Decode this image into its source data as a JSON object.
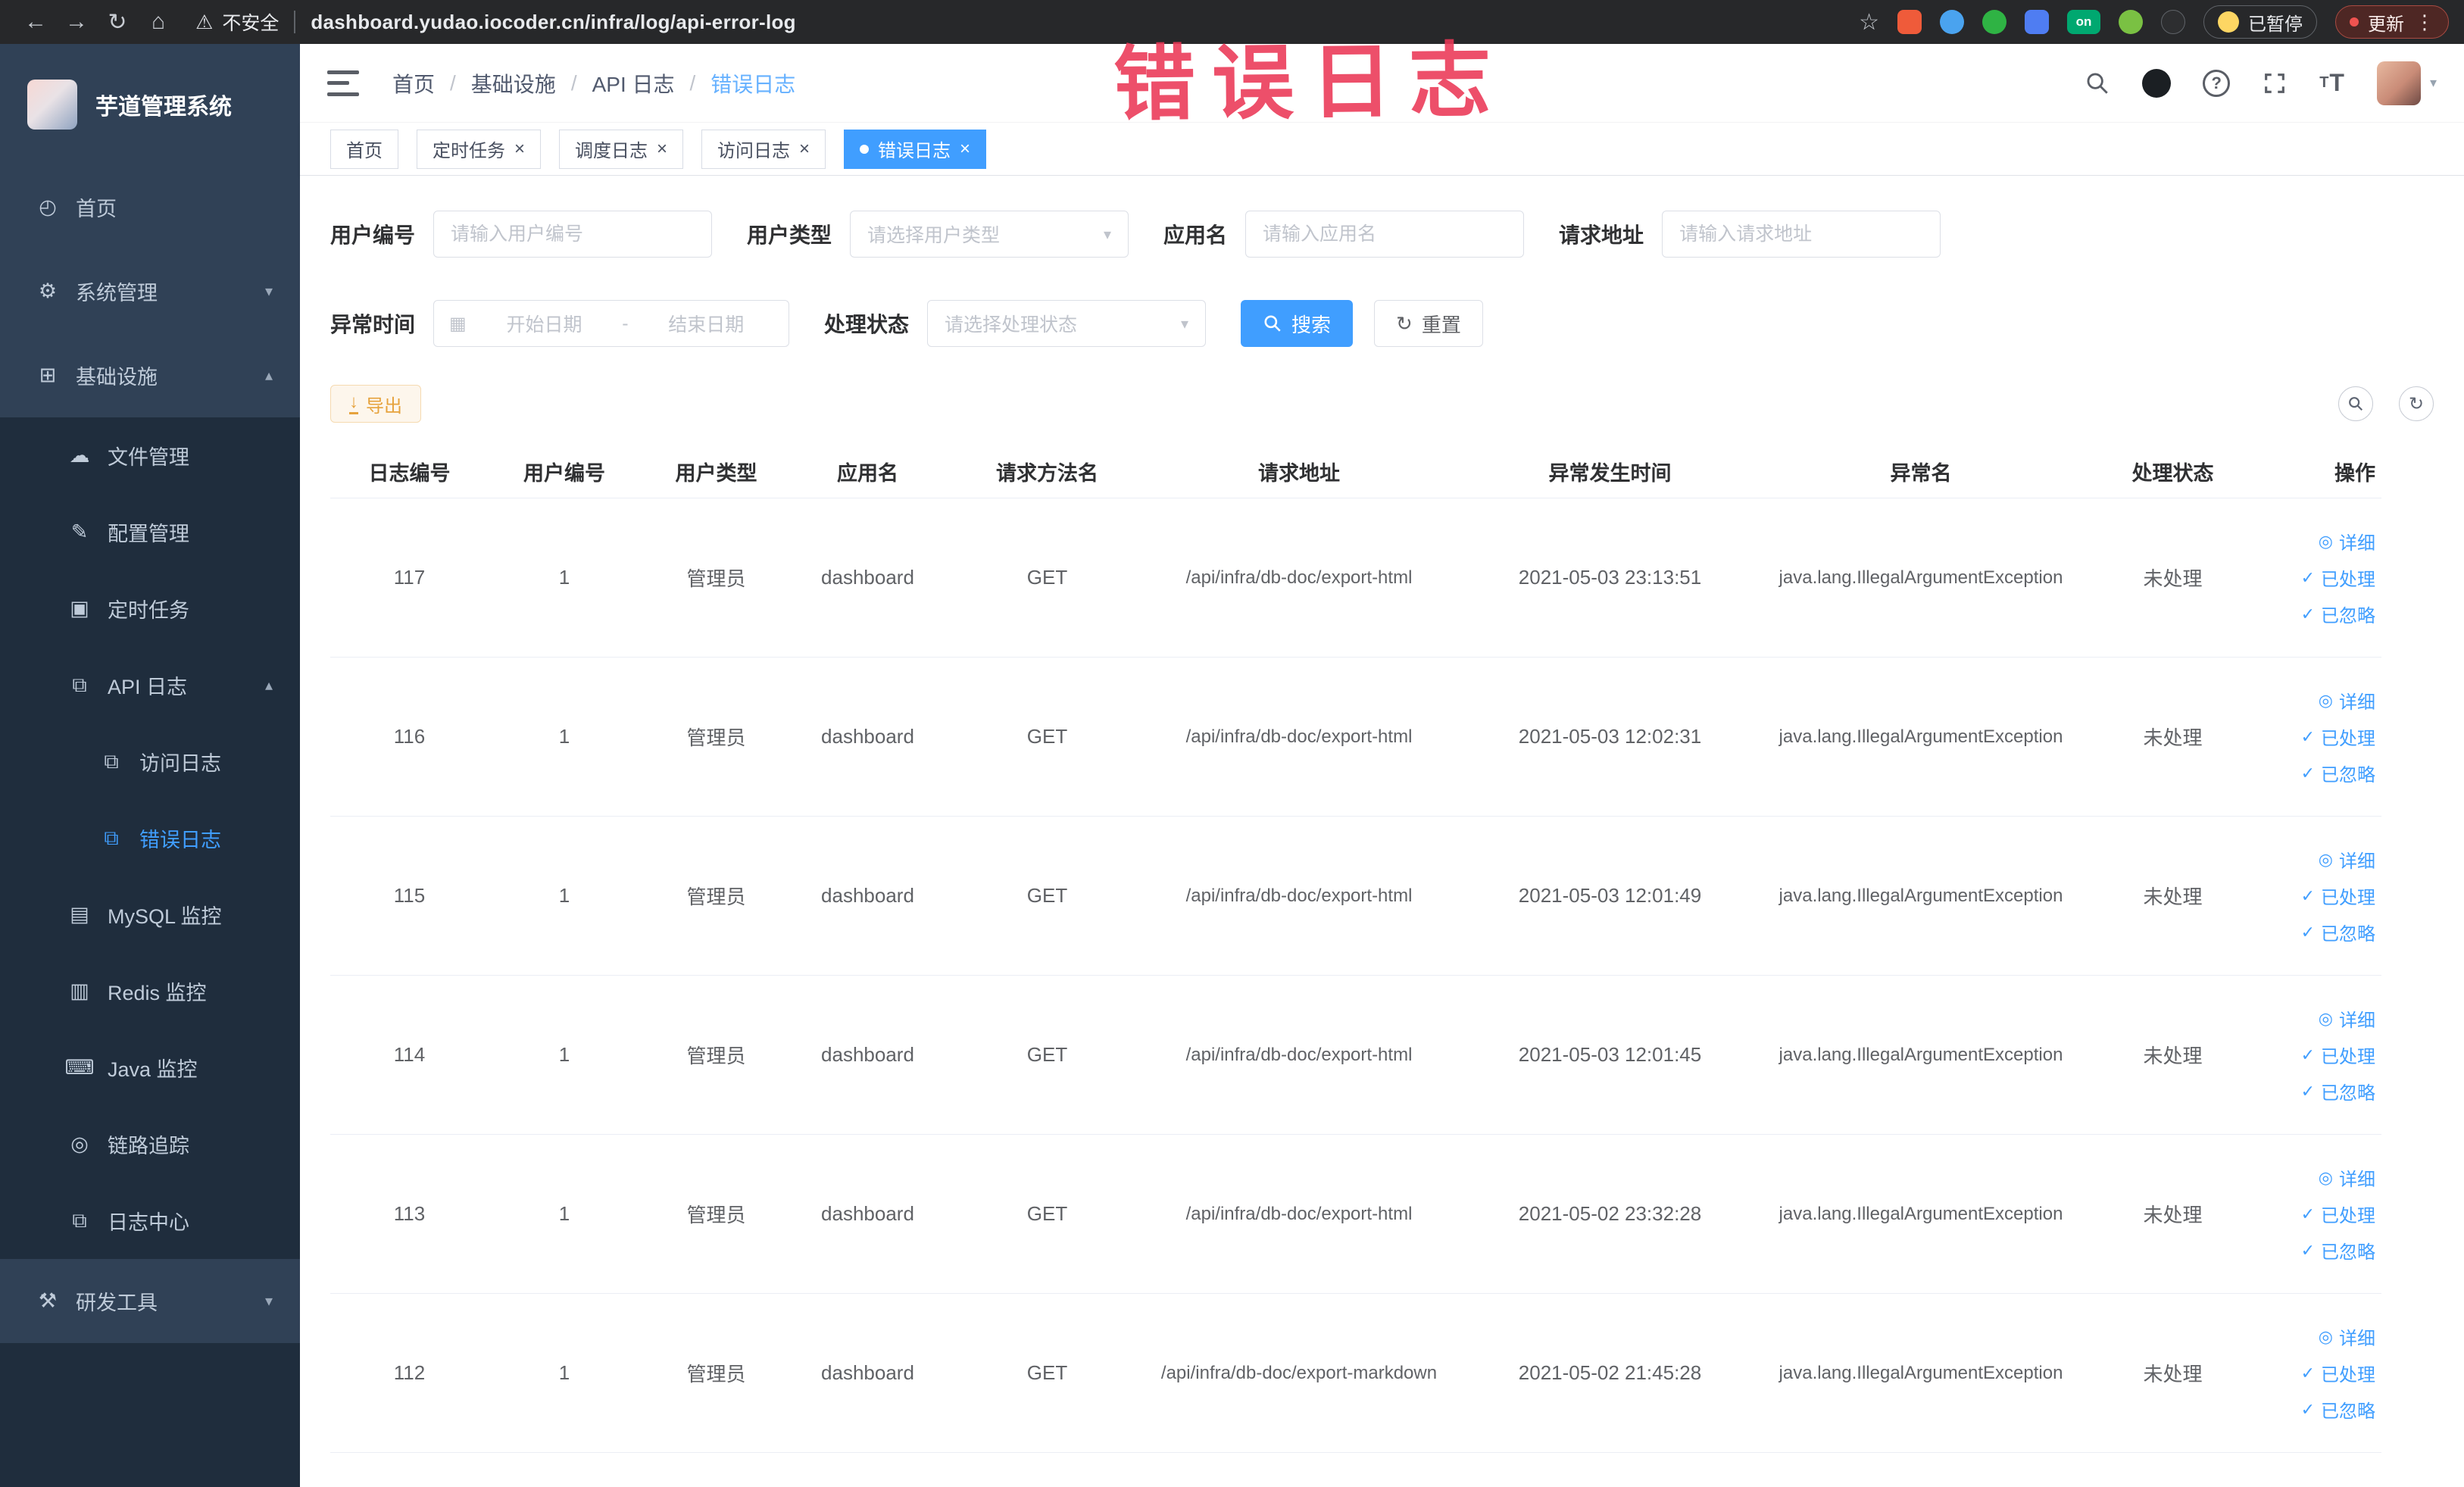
{
  "browser": {
    "security_label": "不安全",
    "url": "dashboard.yudao.iocoder.cn/infra/log/api-error-log",
    "paused_badge": "已暂停",
    "update_label": "更新",
    "extension_on_badge": "on"
  },
  "annotation": {
    "text": "错误日志",
    "color": "rgba(234,55,85,0.88)"
  },
  "sidebar": {
    "title": "芋道管理系统",
    "colors": {
      "bg": "#304156",
      "sub_bg": "#1f2d3d",
      "text": "#bfcbd9",
      "active": "#409eff"
    },
    "items": [
      {
        "key": "home",
        "label": "首页",
        "glyph": "◴",
        "icon": "gauge-icon",
        "level": 1
      },
      {
        "key": "system-management",
        "label": "系统管理",
        "glyph": "⚙",
        "icon": "gear-icon",
        "level": 1,
        "arrow": "down"
      },
      {
        "key": "infrastructure",
        "label": "基础设施",
        "glyph": "⊞",
        "icon": "grid-icon",
        "level": 1,
        "arrow": "up"
      },
      {
        "key": "file-management",
        "label": "文件管理",
        "glyph": "☁",
        "icon": "cloud-icon",
        "level": 2
      },
      {
        "key": "config-management",
        "label": "配置管理",
        "glyph": "✎",
        "icon": "edit-icon",
        "level": 2
      },
      {
        "key": "scheduled-tasks",
        "label": "定时任务",
        "glyph": "▣",
        "icon": "box-icon",
        "level": 2
      },
      {
        "key": "api-log",
        "label": "API 日志",
        "glyph": "⧉",
        "icon": "log-icon",
        "level": 2,
        "arrow": "up"
      },
      {
        "key": "access-log",
        "label": "访问日志",
        "glyph": "⧉",
        "icon": "log-icon",
        "level": 3
      },
      {
        "key": "error-log",
        "label": "错误日志",
        "glyph": "⧉",
        "icon": "log-icon",
        "level": 3,
        "active": true
      },
      {
        "key": "mysql-monitor",
        "label": "MySQL 监控",
        "glyph": "▤",
        "icon": "table-icon",
        "level": 2
      },
      {
        "key": "redis-monitor",
        "label": "Redis 监控",
        "glyph": "▥",
        "icon": "layers-icon",
        "level": 2
      },
      {
        "key": "java-monitor",
        "label": "Java 监控",
        "glyph": "⌨",
        "icon": "monitor-icon",
        "level": 2
      },
      {
        "key": "link-tracing",
        "label": "链路追踪",
        "glyph": "◎",
        "icon": "eye-icon",
        "level": 2
      },
      {
        "key": "log-center",
        "label": "日志中心",
        "glyph": "⧉",
        "icon": "log-icon",
        "level": 2
      },
      {
        "key": "dev-tools",
        "label": "研发工具",
        "glyph": "⚒",
        "icon": "tools-icon",
        "level": 1,
        "arrow": "down"
      }
    ]
  },
  "header": {
    "breadcrumbs": [
      "首页",
      "基础设施",
      "API 日志",
      "错误日志"
    ]
  },
  "tabs": [
    {
      "key": "home",
      "label": "首页",
      "closable": false,
      "active": false
    },
    {
      "key": "timed-task",
      "label": "定时任务",
      "closable": true,
      "active": false
    },
    {
      "key": "schedule-log",
      "label": "调度日志",
      "closable": true,
      "active": false
    },
    {
      "key": "access-log",
      "label": "访问日志",
      "closable": true,
      "active": false
    },
    {
      "key": "error-log",
      "label": "错误日志",
      "closable": true,
      "active": true
    }
  ],
  "filters": {
    "user_id": {
      "label": "用户编号",
      "placeholder": "请输入用户编号"
    },
    "user_type": {
      "label": "用户类型",
      "placeholder": "请选择用户类型"
    },
    "app_name": {
      "label": "应用名",
      "placeholder": "请输入应用名"
    },
    "request_url": {
      "label": "请求地址",
      "placeholder": "请输入请求地址"
    },
    "exception_time": {
      "label": "异常时间",
      "start_placeholder": "开始日期",
      "separator": "-",
      "end_placeholder": "结束日期"
    },
    "process_status": {
      "label": "处理状态",
      "placeholder": "请选择处理状态"
    },
    "search_button": "搜索",
    "reset_button": "重置"
  },
  "toolbar": {
    "export_button": "导出"
  },
  "table": {
    "columns": [
      "日志编号",
      "用户编号",
      "用户类型",
      "应用名",
      "请求方法名",
      "请求地址",
      "异常发生时间",
      "异常名",
      "处理状态",
      "操作"
    ],
    "actions": [
      "详细",
      "已处理",
      "已忽略"
    ],
    "rows": [
      {
        "id": "117",
        "user_id": "1",
        "user_type": "管理员",
        "app": "dashboard",
        "method": "GET",
        "url": "/api/infra/db-doc/export-html",
        "time": "2021-05-03 23:13:51",
        "exception": "java.lang.IllegalArgumentException",
        "status": "未处理"
      },
      {
        "id": "116",
        "user_id": "1",
        "user_type": "管理员",
        "app": "dashboard",
        "method": "GET",
        "url": "/api/infra/db-doc/export-html",
        "time": "2021-05-03 12:02:31",
        "exception": "java.lang.IllegalArgumentException",
        "status": "未处理"
      },
      {
        "id": "115",
        "user_id": "1",
        "user_type": "管理员",
        "app": "dashboard",
        "method": "GET",
        "url": "/api/infra/db-doc/export-html",
        "time": "2021-05-03 12:01:49",
        "exception": "java.lang.IllegalArgumentException",
        "status": "未处理"
      },
      {
        "id": "114",
        "user_id": "1",
        "user_type": "管理员",
        "app": "dashboard",
        "method": "GET",
        "url": "/api/infra/db-doc/export-html",
        "time": "2021-05-03 12:01:45",
        "exception": "java.lang.IllegalArgumentException",
        "status": "未处理"
      },
      {
        "id": "113",
        "user_id": "1",
        "user_type": "管理员",
        "app": "dashboard",
        "method": "GET",
        "url": "/api/infra/db-doc/export-html",
        "time": "2021-05-02 23:32:28",
        "exception": "java.lang.IllegalArgumentException",
        "status": "未处理"
      },
      {
        "id": "112",
        "user_id": "1",
        "user_type": "管理员",
        "app": "dashboard",
        "method": "GET",
        "url": "/api/infra/db-doc/export-markdown",
        "time": "2021-05-02 21:45:28",
        "exception": "java.lang.IllegalArgumentException",
        "status": "未处理"
      }
    ]
  }
}
